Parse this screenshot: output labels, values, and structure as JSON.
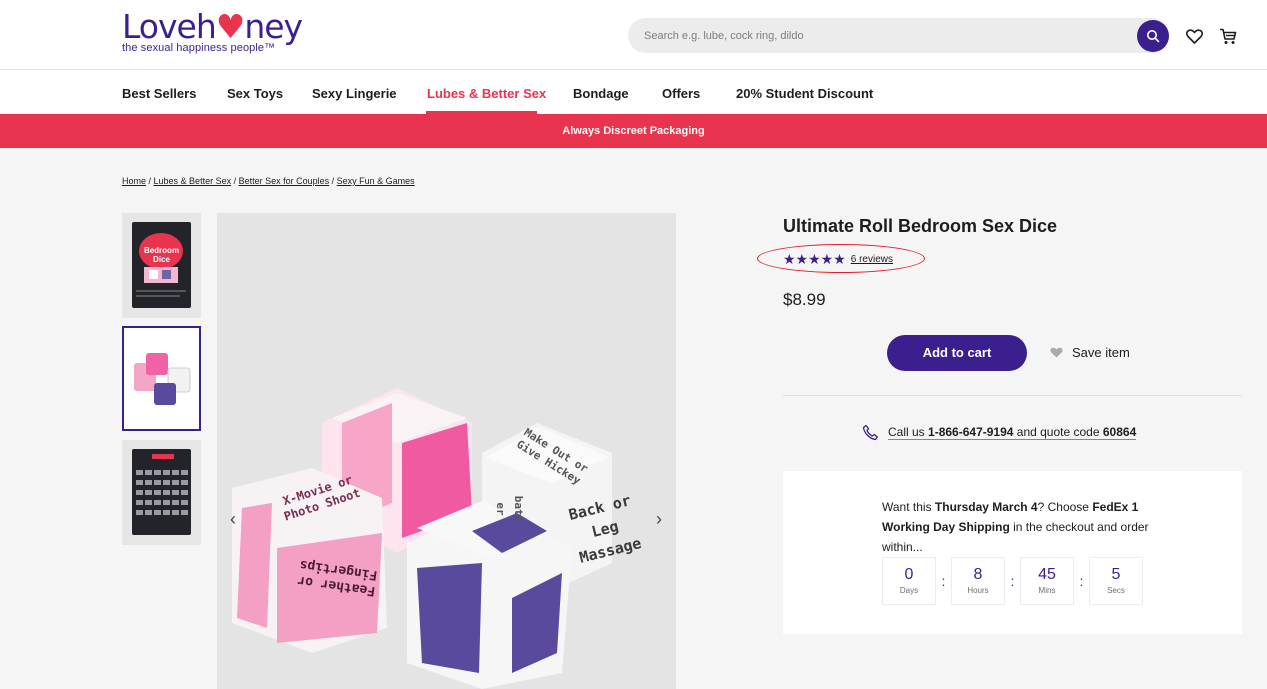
{
  "header": {
    "logo_left": "Loveh",
    "logo_heart": "♥",
    "logo_right": "ney",
    "logo_tagline": "the sexual happiness people™",
    "search_placeholder": "Search e.g. lube, cock ring, dildo"
  },
  "nav": {
    "items": [
      {
        "label": "Best Sellers"
      },
      {
        "label": "Sex Toys"
      },
      {
        "label": "Sexy Lingerie"
      },
      {
        "label": "Lubes & Better Sex"
      },
      {
        "label": "Bondage"
      },
      {
        "label": "Offers"
      },
      {
        "label": "20% Student Discount"
      }
    ]
  },
  "banner": {
    "text": "Always Discreet Packaging"
  },
  "breadcrumb": {
    "items": [
      "Home",
      "Lubes & Better Sex",
      "Better Sex for Couples",
      "Sexy Fun & Games"
    ],
    "separator": " / "
  },
  "product": {
    "title": "Ultimate Roll Bedroom Sex Dice",
    "stars": "★★★★★",
    "rating_value": 5,
    "reviews": "6 reviews",
    "price": "$8.99",
    "add_to_cart": "Add to cart",
    "save_item": "Save item",
    "call_prefix": "Call us",
    "phone": "1-866-647-9194",
    "call_middle": "and quote code",
    "code": "60864"
  },
  "delivery": {
    "text_1": "Want this ",
    "day": "Thursday March 4",
    "text_2": "? Choose ",
    "carrier": "FedEx 1 Working Day Shipping",
    "text_3": " in the checkout and order within...",
    "countdown": [
      {
        "value": "0",
        "label": "Days"
      },
      {
        "value": "8",
        "label": "Hours"
      },
      {
        "value": "45",
        "label": "Mins"
      },
      {
        "value": "5",
        "label": "Secs"
      }
    ],
    "separator": ":"
  },
  "dice": {
    "pink_left_top": "X-Movie or Photo Shoot",
    "pink_left_bottom": "Feather or Fingertips",
    "white_top": "Make Out or Give Hickey",
    "white_side": "Back or Leg Massage",
    "white_partial": "bate er"
  },
  "thumbnail_1": {
    "title": "Bedroom Dice"
  },
  "colors": {
    "brand_purple": "#3c1f8f",
    "brand_red": "#e8344e",
    "highlight_red": "#e11d2a"
  }
}
